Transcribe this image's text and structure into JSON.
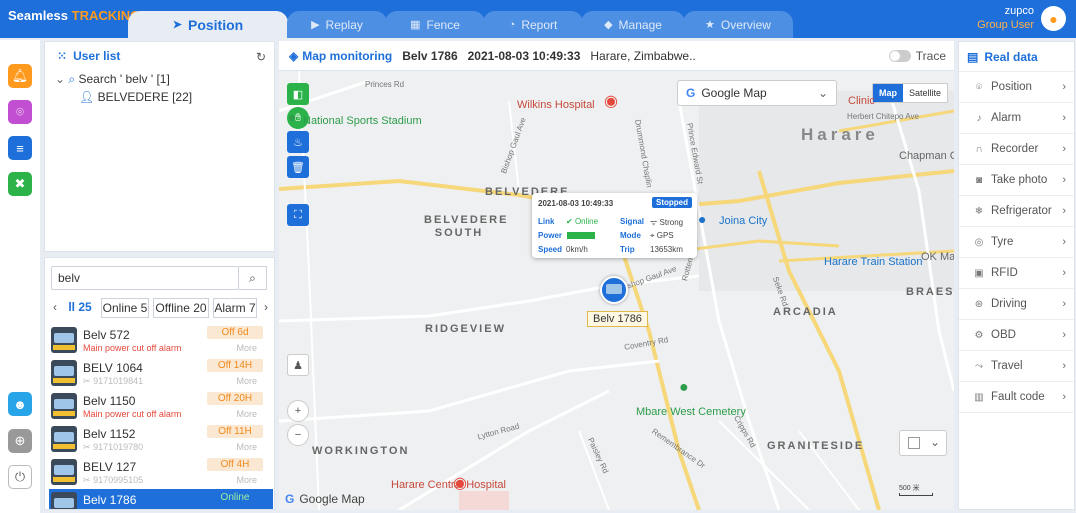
{
  "brand": {
    "part1": "Seamless",
    "part2": "TRACKING"
  },
  "tabs": [
    {
      "label": "Position",
      "icon": "navigation-icon",
      "active": true
    },
    {
      "label": "Replay",
      "icon": "video-icon"
    },
    {
      "label": "Fence",
      "icon": "fence-icon"
    },
    {
      "label": "Report",
      "icon": "pie-chart-icon"
    },
    {
      "label": "Manage",
      "icon": "cube-icon"
    },
    {
      "label": "Overview",
      "icon": "star-icon"
    }
  ],
  "user": {
    "name": "zupco",
    "role": "Group User"
  },
  "userlist": {
    "title": "User list",
    "search_node": "Search ' belv '",
    "search_count": "[1]",
    "child_node": "BELVEDERE",
    "child_count": "[22]"
  },
  "vehicle_search": {
    "value": "belv"
  },
  "filter_tabs": {
    "all": "ll 25",
    "online": "Online 5",
    "offline": "Offline 20",
    "alarm": "Alarm 7"
  },
  "vehicles": [
    {
      "name": "Belv 572",
      "status": "Off 6d",
      "sub": "Main power cut off alarm",
      "more": "More"
    },
    {
      "name": "BELV 1064",
      "status": "Off 14H",
      "sub": "9171019841",
      "more": "More"
    },
    {
      "name": "Belv 1150",
      "status": "Off 20H",
      "sub": "Main power cut off alarm",
      "more": "More"
    },
    {
      "name": "Belv 1152",
      "status": "Off 11H",
      "sub": "9171019780",
      "more": "More"
    },
    {
      "name": "BELV 127",
      "status": "Off 4H",
      "sub": "9170995105",
      "more": "More"
    },
    {
      "name": "Belv 1786",
      "status": "Online",
      "sub": "",
      "more": ""
    }
  ],
  "map_header": {
    "title": "Map monitoring",
    "vehicle": "Belv 1786",
    "datetime": "2021-08-03 10:49:33",
    "location": "Harare, Zimbabwe..",
    "trace_label": "Trace"
  },
  "map": {
    "provider_select": "Google Map",
    "type_map": "Map",
    "type_satellite": "Satellite",
    "watermark": "Google Map",
    "scale": "500 米",
    "labels": {
      "princes_rd": "Princes Rd",
      "wilkins": "Wilkins Hospital",
      "harare": "Harare",
      "national_stadium": "National Sports Stadium",
      "clinic": "Clinic",
      "herbert": "Herbert Chitepo Ave",
      "chapman": "Chapman G",
      "belvedere": "BELVEDERE",
      "belvedere_south": "BELVEDERE SOUTH",
      "joina": "Joina City",
      "harare_train": "Harare Train Station",
      "ok_ma": "OK Ma",
      "braesi": "BRAESI",
      "arcadia": "ARCADIA",
      "ridgeview": "RIDGEVIEW",
      "mbare": "Mbare West Cemetery",
      "workington": "WORKINGTON",
      "graniteside": "GRANITESIDE",
      "harare_central": "Harare Central Hospital",
      "rotten_row": "Rotten Row",
      "coventry": "Coventry Rd",
      "lytton": "Lytton Road",
      "bishop_gaul": "Bishop Gaul Ave",
      "remembrance": "Remembrance Dr",
      "paisley": "Paisley Rd",
      "seke": "Seke Rd",
      "crips": "Cripps Rd",
      "drummond": "Drummond Chaplin",
      "prince_edward": "Prince Edward St",
      "kaguvi": "Bishop Gaul Ave"
    }
  },
  "popup": {
    "datetime": "2021-08-03 10:49:33",
    "badge": "Stopped",
    "link_k": "Link",
    "link_v": "Online",
    "signal_k": "Signal",
    "signal_v": "Strong",
    "power_k": "Power",
    "mode_k": "Mode",
    "mode_v": "GPS",
    "speed_k": "Speed",
    "speed_v": "0km/h",
    "trip_k": "Trip",
    "trip_v": "13653km"
  },
  "vehicle_marker_label": "Belv 1786",
  "realdata": {
    "title": "Real data",
    "items": [
      {
        "label": "Position",
        "icon": "location-pin-icon"
      },
      {
        "label": "Alarm",
        "icon": "bell-icon"
      },
      {
        "label": "Recorder",
        "icon": "headphones-icon"
      },
      {
        "label": "Take photo",
        "icon": "camera-icon"
      },
      {
        "label": "Refrigerator",
        "icon": "snowflake-icon"
      },
      {
        "label": "Tyre",
        "icon": "tyre-icon"
      },
      {
        "label": "RFID",
        "icon": "rfid-icon"
      },
      {
        "label": "Driving",
        "icon": "steering-icon"
      },
      {
        "label": "OBD",
        "icon": "engine-icon"
      },
      {
        "label": "Travel",
        "icon": "route-icon"
      },
      {
        "label": "Fault code",
        "icon": "fault-code-icon"
      }
    ]
  },
  "colors": {
    "primary": "#1e6fd9",
    "brand_accent": "#ff9a1f",
    "alarm": "#e5483b"
  }
}
